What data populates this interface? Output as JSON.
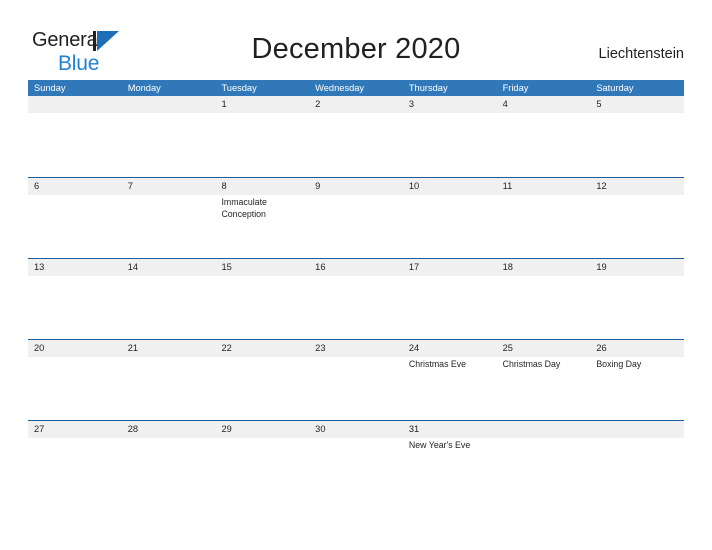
{
  "brand": {
    "name_part1": "General",
    "name_part2": "Blue",
    "mark_icon": "triangle-flag-icon",
    "color_dark": "#231f20",
    "color_blue": "#1f82d6"
  },
  "header": {
    "title": "December 2020",
    "country": "Liechtenstein"
  },
  "theme": {
    "header_blue": "#3178b8",
    "row_rule_blue": "#1f5c99",
    "number_band_gray": "#f0f0f0",
    "text_dark": "#231f20"
  },
  "calendar": {
    "month": "December",
    "year": "2020",
    "weekday_headers": [
      "Sunday",
      "Monday",
      "Tuesday",
      "Wednesday",
      "Thursday",
      "Friday",
      "Saturday"
    ],
    "weeks": [
      {
        "days": [
          {
            "number": "",
            "events": []
          },
          {
            "number": "",
            "events": []
          },
          {
            "number": "1",
            "events": []
          },
          {
            "number": "2",
            "events": []
          },
          {
            "number": "3",
            "events": []
          },
          {
            "number": "4",
            "events": []
          },
          {
            "number": "5",
            "events": []
          }
        ]
      },
      {
        "days": [
          {
            "number": "6",
            "events": []
          },
          {
            "number": "7",
            "events": []
          },
          {
            "number": "8",
            "events": [
              "Immaculate Conception"
            ]
          },
          {
            "number": "9",
            "events": []
          },
          {
            "number": "10",
            "events": []
          },
          {
            "number": "11",
            "events": []
          },
          {
            "number": "12",
            "events": []
          }
        ]
      },
      {
        "days": [
          {
            "number": "13",
            "events": []
          },
          {
            "number": "14",
            "events": []
          },
          {
            "number": "15",
            "events": []
          },
          {
            "number": "16",
            "events": []
          },
          {
            "number": "17",
            "events": []
          },
          {
            "number": "18",
            "events": []
          },
          {
            "number": "19",
            "events": []
          }
        ]
      },
      {
        "days": [
          {
            "number": "20",
            "events": []
          },
          {
            "number": "21",
            "events": []
          },
          {
            "number": "22",
            "events": []
          },
          {
            "number": "23",
            "events": []
          },
          {
            "number": "24",
            "events": [
              "Christmas Eve"
            ]
          },
          {
            "number": "25",
            "events": [
              "Christmas Day"
            ]
          },
          {
            "number": "26",
            "events": [
              "Boxing Day"
            ]
          }
        ]
      },
      {
        "days": [
          {
            "number": "27",
            "events": []
          },
          {
            "number": "28",
            "events": []
          },
          {
            "number": "29",
            "events": []
          },
          {
            "number": "30",
            "events": []
          },
          {
            "number": "31",
            "events": [
              "New Year's Eve"
            ]
          },
          {
            "number": "",
            "events": []
          },
          {
            "number": "",
            "events": []
          }
        ]
      }
    ]
  }
}
